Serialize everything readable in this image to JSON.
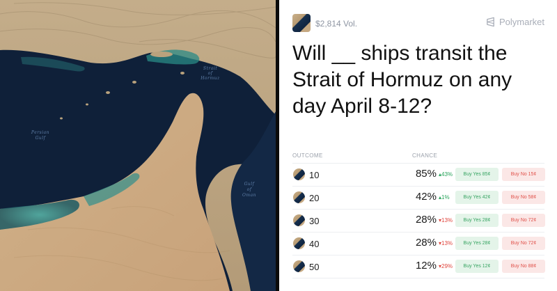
{
  "map": {
    "labels": {
      "strait": [
        "Strait",
        "of",
        "Hormuz"
      ],
      "gulf": [
        "Persian",
        "Gulf"
      ],
      "oman": [
        "Gulf",
        "of",
        "Oman"
      ]
    }
  },
  "market": {
    "volume": "$2,814 Vol.",
    "brand": "Polymarket",
    "title": "Will __ ships transit the Strait of Hormuz on any day April 8-12?",
    "columns": {
      "outcome": "OUTCOME",
      "chance": "CHANCE"
    },
    "outcomes": [
      {
        "label": "10",
        "chance": "85%",
        "delta": "43%",
        "direction": "up",
        "yes": "Buy Yes 85¢",
        "no": "Buy No 15¢"
      },
      {
        "label": "20",
        "chance": "42%",
        "delta": "1%",
        "direction": "up",
        "yes": "Buy Yes 42¢",
        "no": "Buy No 58¢"
      },
      {
        "label": "30",
        "chance": "28%",
        "delta": "13%",
        "direction": "down",
        "yes": "Buy Yes 28¢",
        "no": "Buy No 72¢"
      },
      {
        "label": "40",
        "chance": "28%",
        "delta": "13%",
        "direction": "down",
        "yes": "Buy Yes 28¢",
        "no": "Buy No 72¢"
      },
      {
        "label": "50",
        "chance": "12%",
        "delta": "29%",
        "direction": "down",
        "yes": "Buy Yes 12¢",
        "no": "Buy No 88¢"
      }
    ]
  },
  "colors": {
    "water": "#0e1f38",
    "shallow": "#2d8f8c",
    "desert": "#c9ab80",
    "yes_bg": "#e4f4e9",
    "no_bg": "#fbe7e6"
  }
}
